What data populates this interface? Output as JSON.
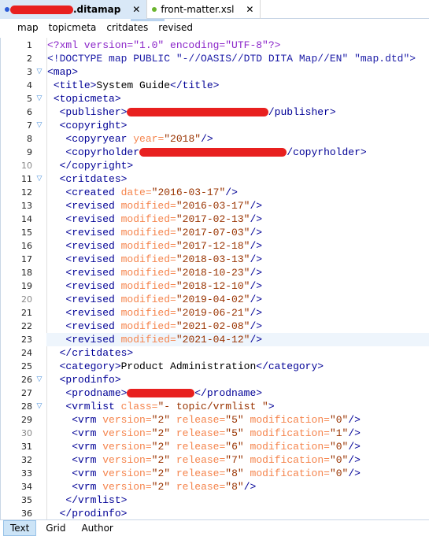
{
  "tabs": [
    {
      "label": ".ditamap",
      "active": true,
      "dot_color": "#2a5bd7",
      "redacted": true
    },
    {
      "label": "front-matter.xsl",
      "active": false,
      "dot_color": "#6ab42d"
    }
  ],
  "breadcrumb": [
    "map",
    "topicmeta",
    "critdates",
    "revised"
  ],
  "colors": {
    "tag": "#000096",
    "attr": "#f5844c",
    "value": "#993300",
    "pi": "#8b26c9",
    "redaction": "#e8201f"
  },
  "current_line": 23,
  "lines": [
    {
      "n": 1,
      "i": 0,
      "t": [
        [
          "pi",
          "<?xml version=\"1.0\" encoding=\"UTF-8\"?>"
        ]
      ]
    },
    {
      "n": 2,
      "i": 0,
      "t": [
        [
          "doctype",
          "<!DOCTYPE map PUBLIC \"-//OASIS//DTD DITA Map//EN\" \"map.dtd\">"
        ]
      ]
    },
    {
      "n": 3,
      "i": 0,
      "f": true,
      "t": [
        [
          "tag",
          "<map>"
        ]
      ]
    },
    {
      "n": 4,
      "i": 1,
      "t": [
        [
          "tag",
          "<title>"
        ],
        [
          "text",
          "System Guide"
        ],
        [
          "tag",
          "</title>"
        ]
      ]
    },
    {
      "n": 5,
      "i": 1,
      "f": true,
      "t": [
        [
          "tag",
          "<topicmeta>"
        ]
      ]
    },
    {
      "n": 6,
      "i": 2,
      "t": [
        [
          "tag",
          "<publisher>"
        ],
        [
          "redact",
          "xxxxxxxxxxxxxxxxxxxxxxx"
        ],
        [
          "tag",
          "/publisher>"
        ]
      ]
    },
    {
      "n": 7,
      "i": 2,
      "f": true,
      "t": [
        [
          "tag",
          "<copyright>"
        ]
      ]
    },
    {
      "n": 8,
      "i": 3,
      "t": [
        [
          "tag",
          "<copyryear "
        ],
        [
          "attr",
          "year="
        ],
        [
          "val",
          "\"2018\""
        ],
        [
          "tag",
          "/>"
        ]
      ]
    },
    {
      "n": 9,
      "i": 3,
      "t": [
        [
          "tag",
          "<copyrholder"
        ],
        [
          "redact",
          "xxxxxxxxxxxxxxxxxxxxxxxx"
        ],
        [
          "tag",
          "/copyrholder>"
        ]
      ]
    },
    {
      "n": 10,
      "i": 2,
      "dim": true,
      "t": [
        [
          "tag",
          "</copyright>"
        ]
      ]
    },
    {
      "n": 11,
      "i": 2,
      "f": true,
      "t": [
        [
          "tag",
          "<critdates>"
        ]
      ]
    },
    {
      "n": 12,
      "i": 3,
      "t": [
        [
          "tag",
          "<created "
        ],
        [
          "attr",
          "date="
        ],
        [
          "val",
          "\"2016-03-17\""
        ],
        [
          "tag",
          "/>"
        ]
      ]
    },
    {
      "n": 13,
      "i": 3,
      "t": [
        [
          "tag",
          "<revised "
        ],
        [
          "attr",
          "modified="
        ],
        [
          "val",
          "\"2016-03-17\""
        ],
        [
          "tag",
          "/>"
        ]
      ]
    },
    {
      "n": 14,
      "i": 3,
      "t": [
        [
          "tag",
          "<revised "
        ],
        [
          "attr",
          "modified="
        ],
        [
          "val",
          "\"2017-02-13\""
        ],
        [
          "tag",
          "/>"
        ]
      ]
    },
    {
      "n": 15,
      "i": 3,
      "t": [
        [
          "tag",
          "<revised "
        ],
        [
          "attr",
          "modified="
        ],
        [
          "val",
          "\"2017-07-03\""
        ],
        [
          "tag",
          "/>"
        ]
      ]
    },
    {
      "n": 16,
      "i": 3,
      "t": [
        [
          "tag",
          "<revised "
        ],
        [
          "attr",
          "modified="
        ],
        [
          "val",
          "\"2017-12-18\""
        ],
        [
          "tag",
          "/>"
        ]
      ]
    },
    {
      "n": 17,
      "i": 3,
      "t": [
        [
          "tag",
          "<revised "
        ],
        [
          "attr",
          "modified="
        ],
        [
          "val",
          "\"2018-03-13\""
        ],
        [
          "tag",
          "/>"
        ]
      ]
    },
    {
      "n": 18,
      "i": 3,
      "t": [
        [
          "tag",
          "<revised "
        ],
        [
          "attr",
          "modified="
        ],
        [
          "val",
          "\"2018-10-23\""
        ],
        [
          "tag",
          "/>"
        ]
      ]
    },
    {
      "n": 19,
      "i": 3,
      "t": [
        [
          "tag",
          "<revised "
        ],
        [
          "attr",
          "modified="
        ],
        [
          "val",
          "\"2018-12-10\""
        ],
        [
          "tag",
          "/>"
        ]
      ]
    },
    {
      "n": 20,
      "i": 3,
      "dim": true,
      "t": [
        [
          "tag",
          "<revised "
        ],
        [
          "attr",
          "modified="
        ],
        [
          "val",
          "\"2019-04-02\""
        ],
        [
          "tag",
          "/>"
        ]
      ]
    },
    {
      "n": 21,
      "i": 3,
      "t": [
        [
          "tag",
          "<revised "
        ],
        [
          "attr",
          "modified="
        ],
        [
          "val",
          "\"2019-06-21\""
        ],
        [
          "tag",
          "/>"
        ]
      ]
    },
    {
      "n": 22,
      "i": 3,
      "t": [
        [
          "tag",
          "<revised "
        ],
        [
          "attr",
          "modified="
        ],
        [
          "val",
          "\"2021-02-08\""
        ],
        [
          "tag",
          "/>"
        ]
      ]
    },
    {
      "n": 23,
      "i": 3,
      "t": [
        [
          "tag",
          "<revised "
        ],
        [
          "attr",
          "modified="
        ],
        [
          "val",
          "\"2021-04-12\""
        ],
        [
          "tag",
          "/>"
        ]
      ]
    },
    {
      "n": 24,
      "i": 2,
      "t": [
        [
          "tag",
          "</critdates>"
        ]
      ]
    },
    {
      "n": 25,
      "i": 2,
      "t": [
        [
          "tag",
          "<category>"
        ],
        [
          "text",
          "Product Administration"
        ],
        [
          "tag",
          "</category>"
        ]
      ]
    },
    {
      "n": 26,
      "i": 2,
      "f": true,
      "t": [
        [
          "tag",
          "<prodinfo>"
        ]
      ]
    },
    {
      "n": 27,
      "i": 3,
      "t": [
        [
          "tag",
          "<prodname>"
        ],
        [
          "redact",
          "xxxxxxxxxxx"
        ],
        [
          "tag",
          "</prodname>"
        ]
      ]
    },
    {
      "n": 28,
      "i": 3,
      "f": true,
      "t": [
        [
          "tag",
          "<vrmlist "
        ],
        [
          "attr",
          "class="
        ],
        [
          "val",
          "\"- topic/vrmlist \""
        ],
        [
          "tag",
          ">"
        ]
      ]
    },
    {
      "n": 29,
      "i": 4,
      "t": [
        [
          "tag",
          "<vrm "
        ],
        [
          "attr",
          "version="
        ],
        [
          "val",
          "\"2\" "
        ],
        [
          "attr",
          "release="
        ],
        [
          "val",
          "\"5\" "
        ],
        [
          "attr",
          "modification="
        ],
        [
          "val",
          "\"0\""
        ],
        [
          "tag",
          "/>"
        ]
      ]
    },
    {
      "n": 30,
      "i": 4,
      "dim": true,
      "t": [
        [
          "tag",
          "<vrm "
        ],
        [
          "attr",
          "version="
        ],
        [
          "val",
          "\"2\" "
        ],
        [
          "attr",
          "release="
        ],
        [
          "val",
          "\"5\" "
        ],
        [
          "attr",
          "modification="
        ],
        [
          "val",
          "\"1\""
        ],
        [
          "tag",
          "/>"
        ]
      ]
    },
    {
      "n": 31,
      "i": 4,
      "t": [
        [
          "tag",
          "<vrm "
        ],
        [
          "attr",
          "version="
        ],
        [
          "val",
          "\"2\" "
        ],
        [
          "attr",
          "release="
        ],
        [
          "val",
          "\"6\" "
        ],
        [
          "attr",
          "modification="
        ],
        [
          "val",
          "\"0\""
        ],
        [
          "tag",
          "/>"
        ]
      ]
    },
    {
      "n": 32,
      "i": 4,
      "t": [
        [
          "tag",
          "<vrm "
        ],
        [
          "attr",
          "version="
        ],
        [
          "val",
          "\"2\" "
        ],
        [
          "attr",
          "release="
        ],
        [
          "val",
          "\"7\" "
        ],
        [
          "attr",
          "modification="
        ],
        [
          "val",
          "\"0\""
        ],
        [
          "tag",
          "/>"
        ]
      ]
    },
    {
      "n": 33,
      "i": 4,
      "t": [
        [
          "tag",
          "<vrm "
        ],
        [
          "attr",
          "version="
        ],
        [
          "val",
          "\"2\" "
        ],
        [
          "attr",
          "release="
        ],
        [
          "val",
          "\"8\" "
        ],
        [
          "attr",
          "modification="
        ],
        [
          "val",
          "\"0\""
        ],
        [
          "tag",
          "/>"
        ]
      ]
    },
    {
      "n": 34,
      "i": 4,
      "t": [
        [
          "tag",
          "<vrm "
        ],
        [
          "attr",
          "version="
        ],
        [
          "val",
          "\"2\" "
        ],
        [
          "attr",
          "release="
        ],
        [
          "val",
          "\"8\""
        ],
        [
          "tag",
          "/>"
        ]
      ]
    },
    {
      "n": 35,
      "i": 3,
      "t": [
        [
          "tag",
          "</vrmlist>"
        ]
      ]
    },
    {
      "n": 36,
      "i": 2,
      "t": [
        [
          "tag",
          "</prodinfo>"
        ]
      ]
    }
  ],
  "bottom_tabs": [
    {
      "label": "Text",
      "active": true
    },
    {
      "label": "Grid"
    },
    {
      "label": "Author"
    }
  ]
}
